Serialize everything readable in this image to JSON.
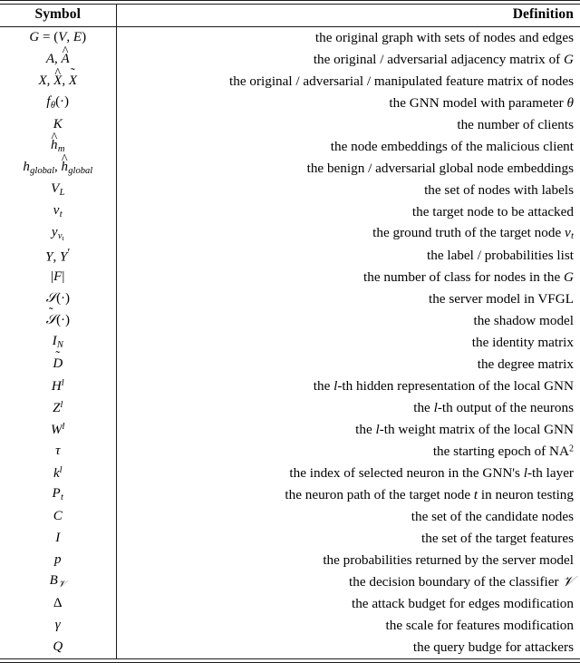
{
  "table": {
    "headers": {
      "symbol": "Symbol",
      "definition": "Definition"
    },
    "rows": [
      {
        "symbol_text": "G = (V, E)",
        "definition": "the original graph with sets of nodes and edges"
      },
      {
        "symbol_text": "A, Â",
        "definition": "the original / adversarial adjacency matrix of G"
      },
      {
        "symbol_text": "X, X̂, X̃",
        "definition": "the original / adversarial / manipulated feature matrix of nodes"
      },
      {
        "symbol_text": "f_θ(·)",
        "definition": "the GNN model with parameter θ"
      },
      {
        "symbol_text": "K",
        "definition": "the number of clients"
      },
      {
        "symbol_text": "ĥ_m",
        "definition": "the node embeddings of the malicious client"
      },
      {
        "symbol_text": "h_global, ĥ_global",
        "definition": "the benign / adversarial global node embeddings"
      },
      {
        "symbol_text": "V_L",
        "definition": "the set of nodes with labels"
      },
      {
        "symbol_text": "v_t",
        "definition": "the target node to be attacked"
      },
      {
        "symbol_text": "y_{v_t}",
        "definition": "the ground truth of the target node v_t"
      },
      {
        "symbol_text": "Y, Y′",
        "definition": "the label / probabilities list"
      },
      {
        "symbol_text": "|F|",
        "definition": "the number of class for nodes in the G"
      },
      {
        "symbol_text": "S(·)",
        "definition": "the server model in VFGL"
      },
      {
        "symbol_text": "S̃(·)",
        "definition": "the shadow model"
      },
      {
        "symbol_text": "I_N",
        "definition": "the identity matrix"
      },
      {
        "symbol_text": "D̃",
        "definition": "the degree matrix"
      },
      {
        "symbol_text": "H^l",
        "definition": "the l-th hidden representation of the local GNN"
      },
      {
        "symbol_text": "Z^l",
        "definition": "the l-th output of the neurons"
      },
      {
        "symbol_text": "W^l",
        "definition": "the l-th weight matrix of the local GNN"
      },
      {
        "symbol_text": "τ",
        "definition": "the starting epoch of NA²"
      },
      {
        "symbol_text": "k^l",
        "definition": "the index of selected neuron in the GNN's l-th layer"
      },
      {
        "symbol_text": "P_t",
        "definition": "the neuron path of the target node t in neuron testing"
      },
      {
        "symbol_text": "C",
        "definition": "the set of the candidate nodes"
      },
      {
        "symbol_text": "I",
        "definition": "the set of the target features"
      },
      {
        "symbol_text": "p",
        "definition": "the probabilities returned by the server model"
      },
      {
        "symbol_text": "B_𝒱",
        "definition": "the decision boundary of the classifier 𝒱"
      },
      {
        "symbol_text": "Δ",
        "definition": "the attack budget for edges modification"
      },
      {
        "symbol_text": "γ",
        "definition": "the scale for features modification"
      },
      {
        "symbol_text": "Q",
        "definition": "the query budge for attackers"
      }
    ]
  }
}
